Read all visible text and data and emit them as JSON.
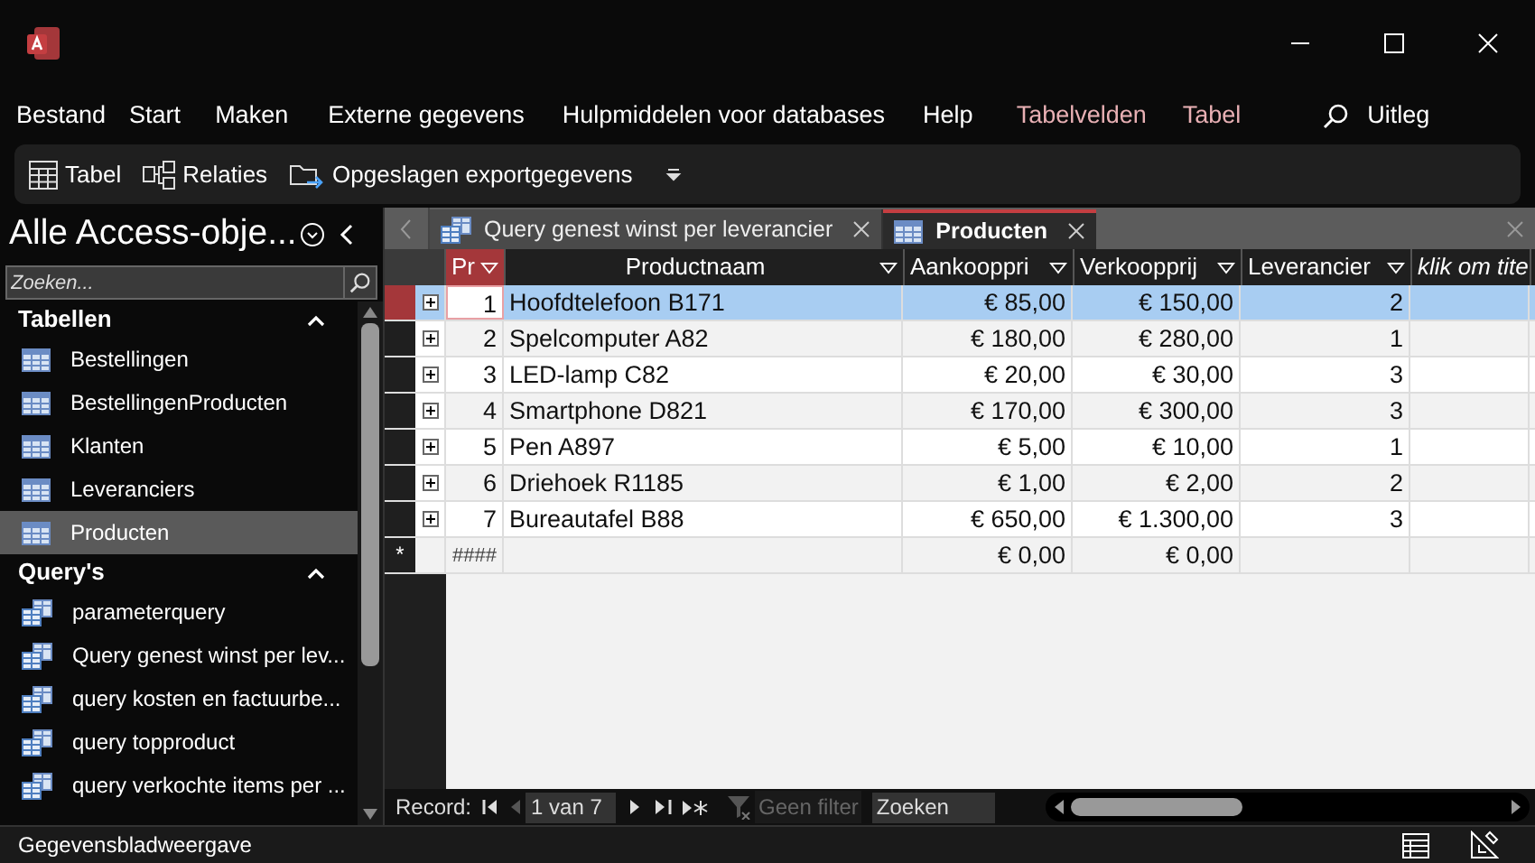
{
  "menu": [
    {
      "label": "Bestand",
      "contextual": false
    },
    {
      "label": "Start",
      "contextual": false
    },
    {
      "label": "Maken",
      "contextual": false
    },
    {
      "label": "Externe gegevens",
      "contextual": false
    },
    {
      "label": "Hulpmiddelen voor databases",
      "contextual": false
    },
    {
      "label": "Help",
      "contextual": false
    },
    {
      "label": "Tabelvelden",
      "contextual": true
    },
    {
      "label": "Tabel",
      "contextual": true
    }
  ],
  "tell_me": "Uitleg",
  "toolbar": [
    {
      "kind": "table",
      "label": "Tabel"
    },
    {
      "kind": "relations",
      "label": "Relaties"
    },
    {
      "kind": "export",
      "label": "Opgeslagen exportgegevens"
    }
  ],
  "nav": {
    "title": "Alle Access-obje...",
    "search_placeholder": "Zoeken...",
    "groups": [
      {
        "label": "Tabellen",
        "expanded": true,
        "items": [
          {
            "kind": "table",
            "label": "Bestellingen",
            "selected": false
          },
          {
            "kind": "table",
            "label": "BestellingenProducten",
            "selected": false
          },
          {
            "kind": "table",
            "label": "Klanten",
            "selected": false
          },
          {
            "kind": "table",
            "label": "Leveranciers",
            "selected": false
          },
          {
            "kind": "table",
            "label": "Producten",
            "selected": true
          }
        ]
      },
      {
        "label": "Query's",
        "expanded": true,
        "items": [
          {
            "kind": "query",
            "label": "parameterquery",
            "selected": false
          },
          {
            "kind": "query",
            "label": "Query genest winst per lev...",
            "selected": false
          },
          {
            "kind": "query",
            "label": "query kosten en factuurbe...",
            "selected": false
          },
          {
            "kind": "query",
            "label": "query topproduct",
            "selected": false
          },
          {
            "kind": "query",
            "label": "query verkochte items per ...",
            "selected": false
          }
        ]
      }
    ]
  },
  "doc_tabs": [
    {
      "kind": "query",
      "label": "Query genest winst per leverancier",
      "selected": false
    },
    {
      "kind": "table",
      "label": "Producten",
      "selected": true
    }
  ],
  "table": {
    "columns": [
      {
        "label": "Pr",
        "current": true,
        "kind": "field"
      },
      {
        "label": "Productnaam",
        "current": false,
        "kind": "field"
      },
      {
        "label": "Aankooppri",
        "current": false,
        "kind": "field"
      },
      {
        "label": "Verkoopprij",
        "current": false,
        "kind": "field"
      },
      {
        "label": "Leverancier",
        "current": false,
        "kind": "field"
      },
      {
        "label": "klik om tite",
        "current": false,
        "kind": "add"
      }
    ],
    "rows": [
      {
        "kind": "record",
        "selected": true,
        "cells": [
          "1",
          "Hoofdtelefoon B171",
          "€ 85,00",
          "€ 150,00",
          "2",
          ""
        ]
      },
      {
        "kind": "record",
        "selected": false,
        "cells": [
          "2",
          "Spelcomputer A82",
          "€ 180,00",
          "€ 280,00",
          "1",
          ""
        ]
      },
      {
        "kind": "record",
        "selected": false,
        "cells": [
          "3",
          "LED-lamp C82",
          "€ 20,00",
          "€ 30,00",
          "3",
          ""
        ]
      },
      {
        "kind": "record",
        "selected": false,
        "cells": [
          "4",
          "Smartphone D821",
          "€ 170,00",
          "€ 300,00",
          "3",
          ""
        ]
      },
      {
        "kind": "record",
        "selected": false,
        "cells": [
          "5",
          "Pen A897",
          "€ 5,00",
          "€ 10,00",
          "1",
          ""
        ]
      },
      {
        "kind": "record",
        "selected": false,
        "cells": [
          "6",
          "Driehoek R1185",
          "€ 1,00",
          "€ 2,00",
          "2",
          ""
        ]
      },
      {
        "kind": "record",
        "selected": false,
        "cells": [
          "7",
          "Bureautafel B88",
          "€ 650,00",
          "€ 1.300,00",
          "3",
          ""
        ]
      },
      {
        "kind": "new",
        "selected": false,
        "marker": "*",
        "cells": [
          "####",
          "",
          "€ 0,00",
          "€ 0,00",
          "",
          ""
        ]
      }
    ]
  },
  "record_nav": {
    "label": "Record:",
    "position": "1 van 7",
    "filter": "Geen filter",
    "search": "Zoeken"
  },
  "status_bar": "Gegevensbladweergave"
}
